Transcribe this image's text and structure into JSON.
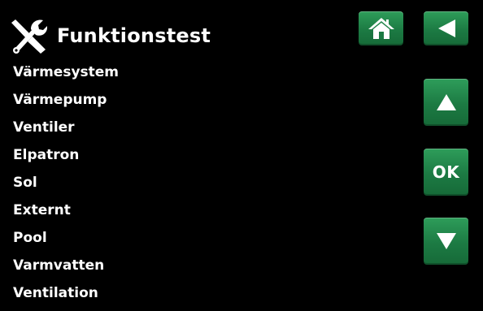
{
  "header": {
    "title": "Funktionstest",
    "icon": "tools-icon"
  },
  "menu": {
    "items": [
      {
        "label": "Värmesystem"
      },
      {
        "label": "Värmepump"
      },
      {
        "label": "Ventiler"
      },
      {
        "label": "Elpatron"
      },
      {
        "label": "Sol"
      },
      {
        "label": "Externt"
      },
      {
        "label": "Pool"
      },
      {
        "label": "Varmvatten"
      },
      {
        "label": "Ventilation"
      }
    ]
  },
  "buttons": {
    "home_icon": "home-icon",
    "back_icon": "back-arrow-icon",
    "up_icon": "arrow-up-icon",
    "ok_label": "OK",
    "down_icon": "arrow-down-icon"
  },
  "colors": {
    "background": "#000000",
    "text": "#ffffff",
    "button_green": "#1c7a43"
  }
}
